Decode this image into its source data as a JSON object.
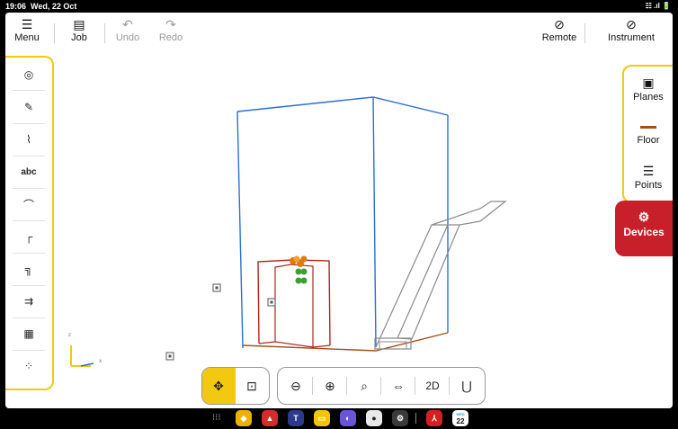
{
  "status_bar": {
    "time": "19:06",
    "date": "Wed, 22 Oct",
    "system_icons": "☷ .ıl 🔋"
  },
  "toolbar": {
    "menu_label": "Menu",
    "job_label": "Job",
    "undo_label": "Undo",
    "redo_label": "Redo",
    "remote_label": "Remote",
    "instrument_label": "Instrument"
  },
  "right_panel": {
    "planes_label": "Planes",
    "floor_label": "Floor",
    "points_label": "Points",
    "devices_label": "Devices"
  },
  "left_panel": {
    "text_tool_label": "abc"
  },
  "bottom_bar": {
    "view_2d_label": "2D"
  },
  "axis": {
    "x_label": "x",
    "z_label": "z"
  },
  "dock": {
    "calendar_day": "22",
    "calendar_top": "WED"
  },
  "colors": {
    "accent_yellow": "#f2c811",
    "devices_red": "#c8202a",
    "wall_blue": "#2a6fd6",
    "door_red": "#b3261e",
    "floor_brown": "#a0521c",
    "stairs_gray": "#8a8a8a",
    "point_orange": "#e07a10",
    "point_green": "#3aa132"
  }
}
